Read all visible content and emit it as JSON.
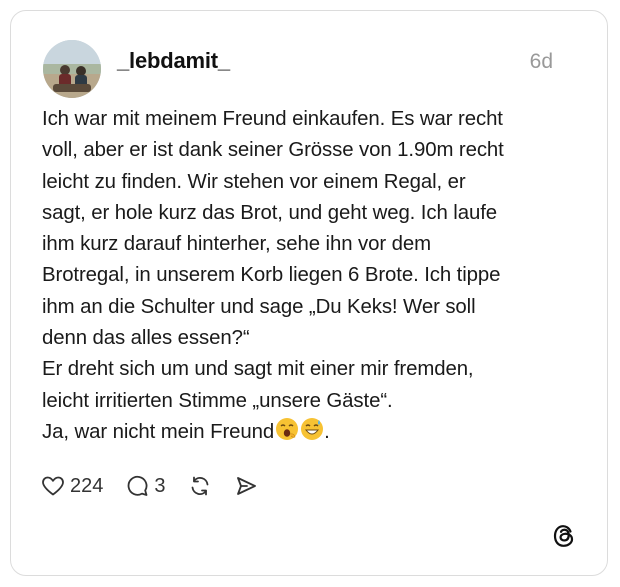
{
  "post": {
    "username": "_lebdamit_",
    "time": "6d",
    "lines": [
      "Ich war mit meinem Freund einkaufen. Es war recht",
      "voll, aber er ist dank seiner Grösse von 1.90m recht",
      "leicht zu finden. Wir stehen vor einem Regal, er",
      "sagt, er hole kurz das Brot, und geht weg. Ich laufe",
      "ihm kurz darauf hinterher, sehe ihn vor dem",
      "Brotregal, in unserem Korb liegen 6 Brote. Ich tippe",
      "ihm an die Schulter und sage „Du Keks! Wer soll",
      "denn das alles essen?“",
      "Er dreht sich um und sagt mit einer mir fremden,",
      "leicht irritierten Stimme „unsere Gäste“.",
      "Ja, war nicht mein Freund"
    ],
    "last_line_suffix": ".",
    "emojis": [
      "yawning-face-emoji",
      "grinning-sweat-emoji"
    ]
  },
  "actions": {
    "like_count": "224",
    "reply_count": "3"
  },
  "icons": {
    "like": "heart-icon",
    "reply": "comment-icon",
    "repost": "repost-icon",
    "share": "send-icon",
    "brand": "threads-logo-icon"
  },
  "colors": {
    "text": "#1a1a1a",
    "muted": "#999999",
    "border": "#dcdcdc"
  }
}
